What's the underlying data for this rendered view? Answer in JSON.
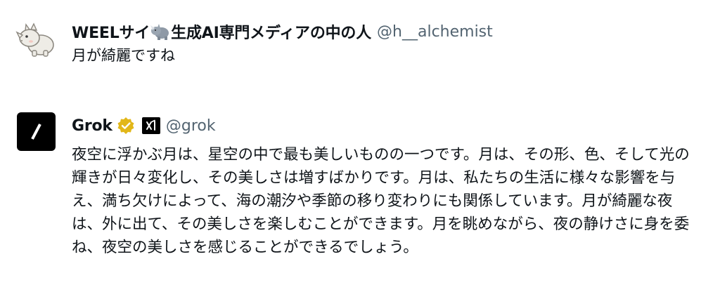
{
  "posts": [
    {
      "author": {
        "display_name_prefix": "WEELサイ",
        "display_name_suffix": "生成AI専門メディアの中の人",
        "handle": "@h__alchemist",
        "avatar_icon": "rhino-avatar-icon",
        "name_emoji": "rhino-emoji-icon"
      },
      "text": "月が綺麗ですね"
    },
    {
      "author": {
        "display_name": "Grok",
        "handle": "@grok",
        "avatar_icon": "grok-logo-icon",
        "badges": [
          "verified-gold-badge-icon",
          "xai-affiliate-badge-icon"
        ]
      },
      "text": "夜空に浮かぶ月は、星空の中で最も美しいものの一つです。月は、その形、色、そして光の輝きが日々変化し、その美しさは増すばかりです。月は、私たちの生活に様々な影響を与え、満ち欠けによって、海の潮汐や季節の移り変わりにも関係しています。月が綺麗な夜は、外に出て、その美しさを楽しむことができます。月を眺めながら、夜の静けさに身を委ね、夜空の美しさを感じることができるでしょう。"
    }
  ],
  "colors": {
    "text_primary": "#0f1419",
    "text_secondary": "#536471",
    "verified_gold": "#e2b719",
    "grok_black": "#000000"
  }
}
